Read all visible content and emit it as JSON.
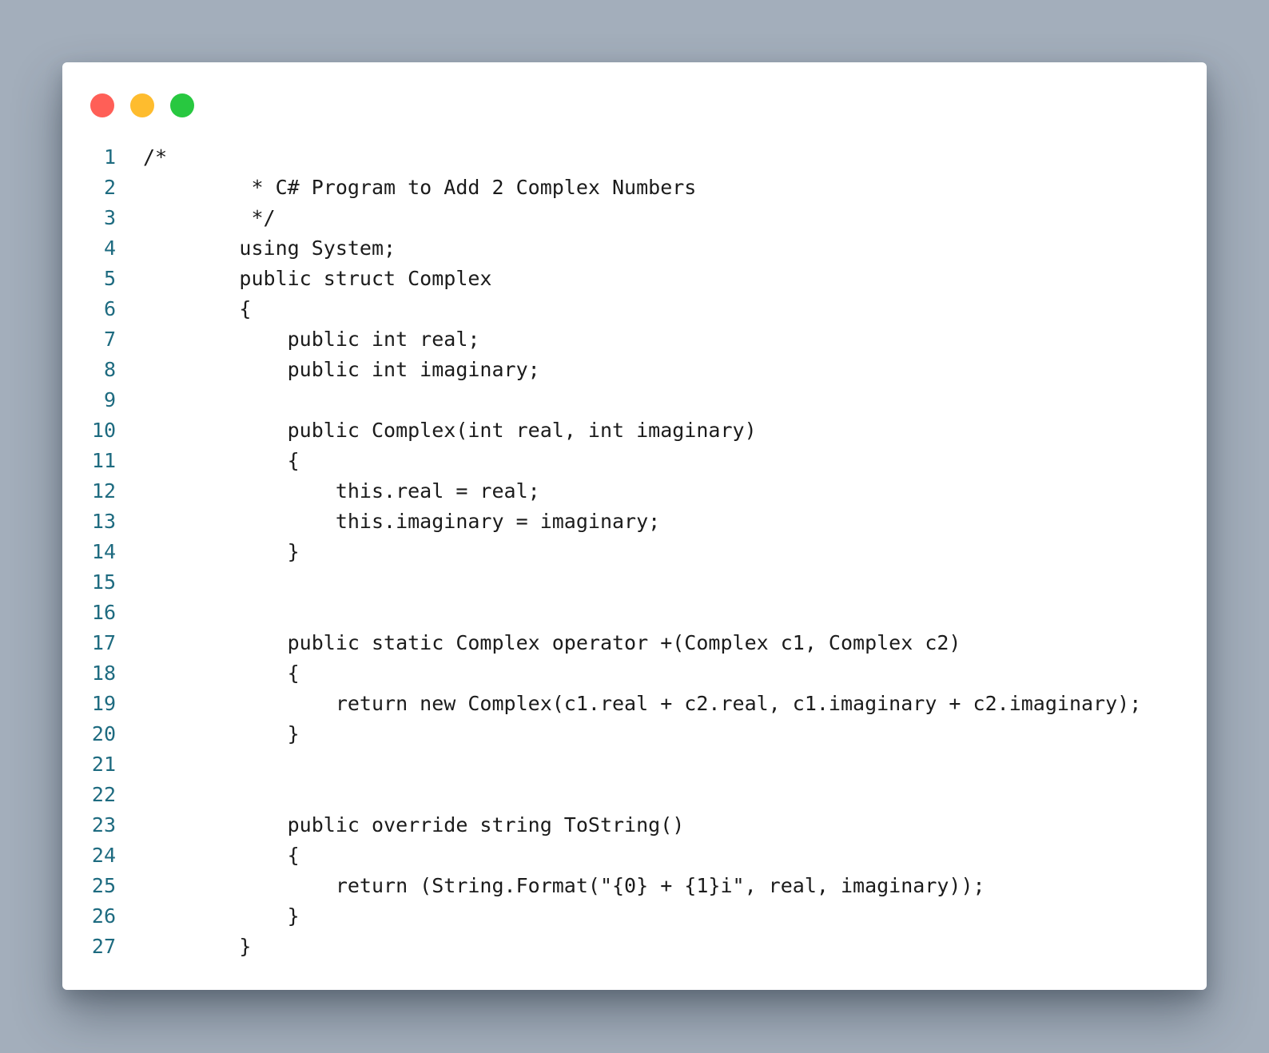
{
  "window": {
    "controls": [
      {
        "name": "close-button",
        "color": "#ff5f57"
      },
      {
        "name": "minimize-button",
        "color": "#febc2e"
      },
      {
        "name": "maximize-button",
        "color": "#28c840"
      }
    ]
  },
  "code": {
    "lines": [
      {
        "num": "1",
        "text": "/*"
      },
      {
        "num": "2",
        "text": "         * C# Program to Add 2 Complex Numbers"
      },
      {
        "num": "3",
        "text": "         */"
      },
      {
        "num": "4",
        "text": "        using System;"
      },
      {
        "num": "5",
        "text": "        public struct Complex"
      },
      {
        "num": "6",
        "text": "        {"
      },
      {
        "num": "7",
        "text": "            public int real;"
      },
      {
        "num": "8",
        "text": "            public int imaginary;"
      },
      {
        "num": "9",
        "text": ""
      },
      {
        "num": "10",
        "text": "            public Complex(int real, int imaginary)"
      },
      {
        "num": "11",
        "text": "            {"
      },
      {
        "num": "12",
        "text": "                this.real = real;"
      },
      {
        "num": "13",
        "text": "                this.imaginary = imaginary;"
      },
      {
        "num": "14",
        "text": "            }"
      },
      {
        "num": "15",
        "text": ""
      },
      {
        "num": "16",
        "text": ""
      },
      {
        "num": "17",
        "text": "            public static Complex operator +(Complex c1, Complex c2)"
      },
      {
        "num": "18",
        "text": "            {"
      },
      {
        "num": "19",
        "text": "                return new Complex(c1.real + c2.real, c1.imaginary + c2.imaginary);"
      },
      {
        "num": "20",
        "text": "            }"
      },
      {
        "num": "21",
        "text": ""
      },
      {
        "num": "22",
        "text": ""
      },
      {
        "num": "23",
        "text": "            public override string ToString()"
      },
      {
        "num": "24",
        "text": "            {"
      },
      {
        "num": "25",
        "text": "                return (String.Format(\"{0} + {1}i\", real, imaginary));"
      },
      {
        "num": "26",
        "text": "            }"
      },
      {
        "num": "27",
        "text": "        }"
      }
    ]
  }
}
